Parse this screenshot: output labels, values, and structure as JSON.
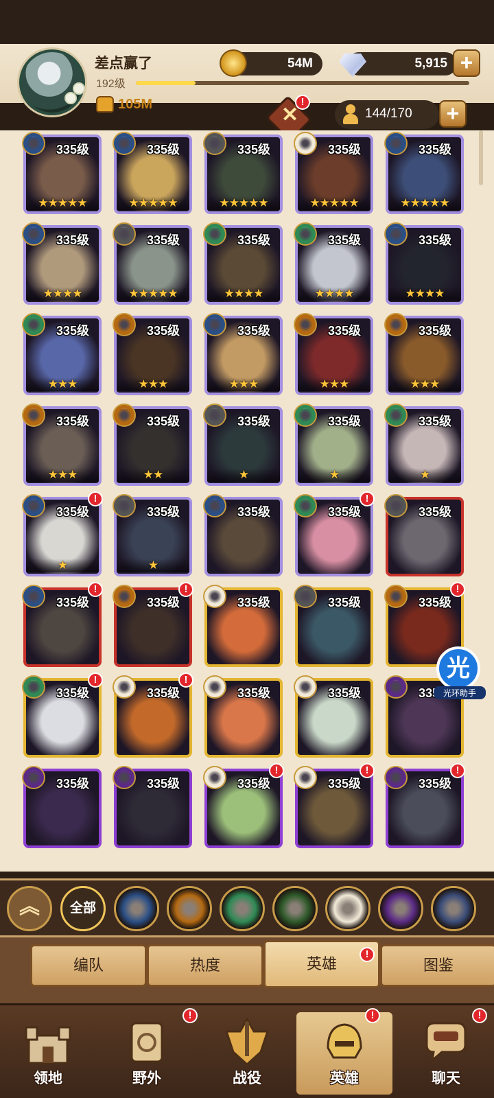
{
  "player": {
    "name": "差点赢了",
    "level": "192级",
    "xp_progress": 0.18,
    "power": "105M"
  },
  "currencies": {
    "gold": "54M",
    "diamonds": "5,915"
  },
  "hero_capacity": "144/170",
  "heroes": [
    {
      "level": "335级",
      "stars": "★★★★★",
      "rarity": "purple",
      "faction": "lightbearer",
      "portrait": "#7a5c4a",
      "notify": ""
    },
    {
      "level": "335级",
      "stars": "★★★★★",
      "rarity": "purple",
      "faction": "lightbearer",
      "portrait": "#caa55c",
      "notify": ""
    },
    {
      "level": "335级",
      "stars": "★★★★★",
      "rarity": "purple",
      "faction": "wilder-eye",
      "portrait": "#3e4a3a",
      "notify": ""
    },
    {
      "level": "335级",
      "stars": "★★★★★",
      "rarity": "purple",
      "faction": "celestial",
      "portrait": "#6b3d2a",
      "notify": ""
    },
    {
      "level": "335级",
      "stars": "★★★★★",
      "rarity": "purple",
      "faction": "lightbearer",
      "portrait": "#3d4f78",
      "notify": ""
    },
    {
      "level": "335级",
      "stars": "★★★★",
      "rarity": "purple",
      "faction": "lightbearer",
      "portrait": "#b09a7c",
      "notify": ""
    },
    {
      "level": "335级",
      "stars": "★★★★★",
      "rarity": "purple",
      "faction": "wilder-eye",
      "portrait": "#8a948a",
      "notify": ""
    },
    {
      "level": "335级",
      "stars": "★★★★",
      "rarity": "purple",
      "faction": "wilder",
      "portrait": "#5b4a35",
      "notify": ""
    },
    {
      "level": "335级",
      "stars": "★★★★",
      "rarity": "purple",
      "faction": "wilder",
      "portrait": "#c3c6cf",
      "notify": ""
    },
    {
      "level": "335级",
      "stars": "★★★★",
      "rarity": "purple",
      "faction": "lightbearer",
      "portrait": "#23252e",
      "notify": ""
    },
    {
      "level": "335级",
      "stars": "★★★",
      "rarity": "purple",
      "faction": "wilder",
      "portrait": "#5867a8",
      "notify": ""
    },
    {
      "level": "335级",
      "stars": "★★★",
      "rarity": "purple",
      "faction": "mauler",
      "portrait": "#4a3524",
      "notify": ""
    },
    {
      "level": "335级",
      "stars": "★★★",
      "rarity": "purple",
      "faction": "lightbearer",
      "portrait": "#c29a63",
      "notify": ""
    },
    {
      "level": "335级",
      "stars": "★★★",
      "rarity": "purple",
      "faction": "mauler",
      "portrait": "#7e2a2a",
      "notify": ""
    },
    {
      "level": "335级",
      "stars": "★★★",
      "rarity": "purple",
      "faction": "mauler",
      "portrait": "#8a5b2a",
      "notify": ""
    },
    {
      "level": "335级",
      "stars": "★★★",
      "rarity": "purple",
      "faction": "mauler",
      "portrait": "#6a5e55",
      "notify": ""
    },
    {
      "level": "335级",
      "stars": "★★",
      "rarity": "purple",
      "faction": "mauler",
      "portrait": "#34302e",
      "notify": ""
    },
    {
      "level": "335级",
      "stars": "★",
      "rarity": "purple",
      "faction": "wilder-eye",
      "portrait": "#2c3a3c",
      "notify": ""
    },
    {
      "level": "335级",
      "stars": "★",
      "rarity": "purple",
      "faction": "wilder",
      "portrait": "#a2b08a",
      "notify": ""
    },
    {
      "level": "335级",
      "stars": "★",
      "rarity": "purple",
      "faction": "wilder",
      "portrait": "#c6b7b7",
      "notify": ""
    },
    {
      "level": "335级",
      "stars": "★",
      "rarity": "purple",
      "faction": "lightbearer",
      "portrait": "#d8d7d2",
      "notify": "!"
    },
    {
      "level": "335级",
      "stars": "★",
      "rarity": "purple",
      "faction": "wilder-eye",
      "portrait": "#3a4255",
      "notify": ""
    },
    {
      "level": "335级",
      "stars": "",
      "rarity": "purple",
      "faction": "lightbearer",
      "portrait": "#5a4a3a",
      "notify": ""
    },
    {
      "level": "335级",
      "stars": "",
      "rarity": "purple",
      "faction": "wilder",
      "portrait": "#d98fa3",
      "notify": "!"
    },
    {
      "level": "335级",
      "stars": "",
      "rarity": "red",
      "faction": "wilder-eye",
      "portrait": "#6d6870",
      "notify": ""
    },
    {
      "level": "335级",
      "stars": "",
      "rarity": "red",
      "faction": "lightbearer",
      "portrait": "#4e4640",
      "notify": "!"
    },
    {
      "level": "335级",
      "stars": "",
      "rarity": "red",
      "faction": "mauler",
      "portrait": "#3e2f28",
      "notify": "!"
    },
    {
      "level": "335级",
      "stars": "",
      "rarity": "gold",
      "faction": "celestial",
      "portrait": "#d36b3a",
      "notify": ""
    },
    {
      "level": "335级",
      "stars": "",
      "rarity": "gold",
      "faction": "wilder-eye",
      "portrait": "#3b5866",
      "notify": ""
    },
    {
      "level": "335级",
      "stars": "",
      "rarity": "gold",
      "faction": "mauler",
      "portrait": "#7a2a1c",
      "notify": "!"
    },
    {
      "level": "335级",
      "stars": "",
      "rarity": "gold",
      "faction": "wilder",
      "portrait": "#dcdde2",
      "notify": "!"
    },
    {
      "level": "335级",
      "stars": "",
      "rarity": "gold",
      "faction": "celestial",
      "portrait": "#c36a2a",
      "notify": "!"
    },
    {
      "level": "335级",
      "stars": "",
      "rarity": "gold",
      "faction": "celestial",
      "portrait": "#d9774a",
      "notify": ""
    },
    {
      "level": "335级",
      "stars": "",
      "rarity": "gold",
      "faction": "celestial",
      "portrait": "#c9d8c8",
      "notify": ""
    },
    {
      "level": "335级",
      "stars": "",
      "rarity": "gold",
      "faction": "hypogean",
      "portrait": "#4d3656",
      "notify": ""
    },
    {
      "level": "335级",
      "stars": "",
      "rarity": "violet",
      "faction": "hypogean",
      "portrait": "#3b2a4e",
      "notify": ""
    },
    {
      "level": "335级",
      "stars": "",
      "rarity": "violet",
      "faction": "hypogean",
      "portrait": "#2e2a36",
      "notify": ""
    },
    {
      "level": "335级",
      "stars": "",
      "rarity": "violet",
      "faction": "celestial",
      "portrait": "#9cc07a",
      "notify": "!"
    },
    {
      "level": "335级",
      "stars": "",
      "rarity": "violet",
      "faction": "celestial",
      "portrait": "#6e5a3a",
      "notify": "!"
    },
    {
      "level": "335级",
      "stars": "",
      "rarity": "violet",
      "faction": "hypogean",
      "portrait": "#4b4e5a",
      "notify": "!"
    }
  ],
  "helper": {
    "glyph": "光",
    "caption": "光环助手"
  },
  "filters": {
    "collapse_glyph": "︽",
    "all_label": "全部",
    "factions": [
      "lightbearer",
      "mauler",
      "wilder",
      "graveborn",
      "celestial",
      "hypogean",
      "dimensional"
    ]
  },
  "subtabs": [
    {
      "label": "编队",
      "notify": ""
    },
    {
      "label": "热度",
      "notify": ""
    },
    {
      "label": "英雄",
      "notify": "!",
      "active": true
    },
    {
      "label": "图鉴",
      "notify": ""
    }
  ],
  "nav": [
    {
      "label": "领地",
      "icon": "castle-icon",
      "notify": ""
    },
    {
      "label": "野外",
      "icon": "scroll-map-icon",
      "notify": "!"
    },
    {
      "label": "战役",
      "icon": "battle-crest-icon",
      "notify": ""
    },
    {
      "label": "英雄",
      "icon": "hero-helmet-icon",
      "notify": "!",
      "active": true
    },
    {
      "label": "聊天",
      "icon": "chat-bubble-icon",
      "notify": "!"
    }
  ],
  "colors": {
    "lightbearer": "#2a4f86",
    "mauler": "#b56a12",
    "wilder": "#2f8a55",
    "graveborn": "#2e5a2a",
    "celestial": "#f2ead8",
    "hypogean": "#5b2a86",
    "dimensional": "#3a4c78"
  }
}
